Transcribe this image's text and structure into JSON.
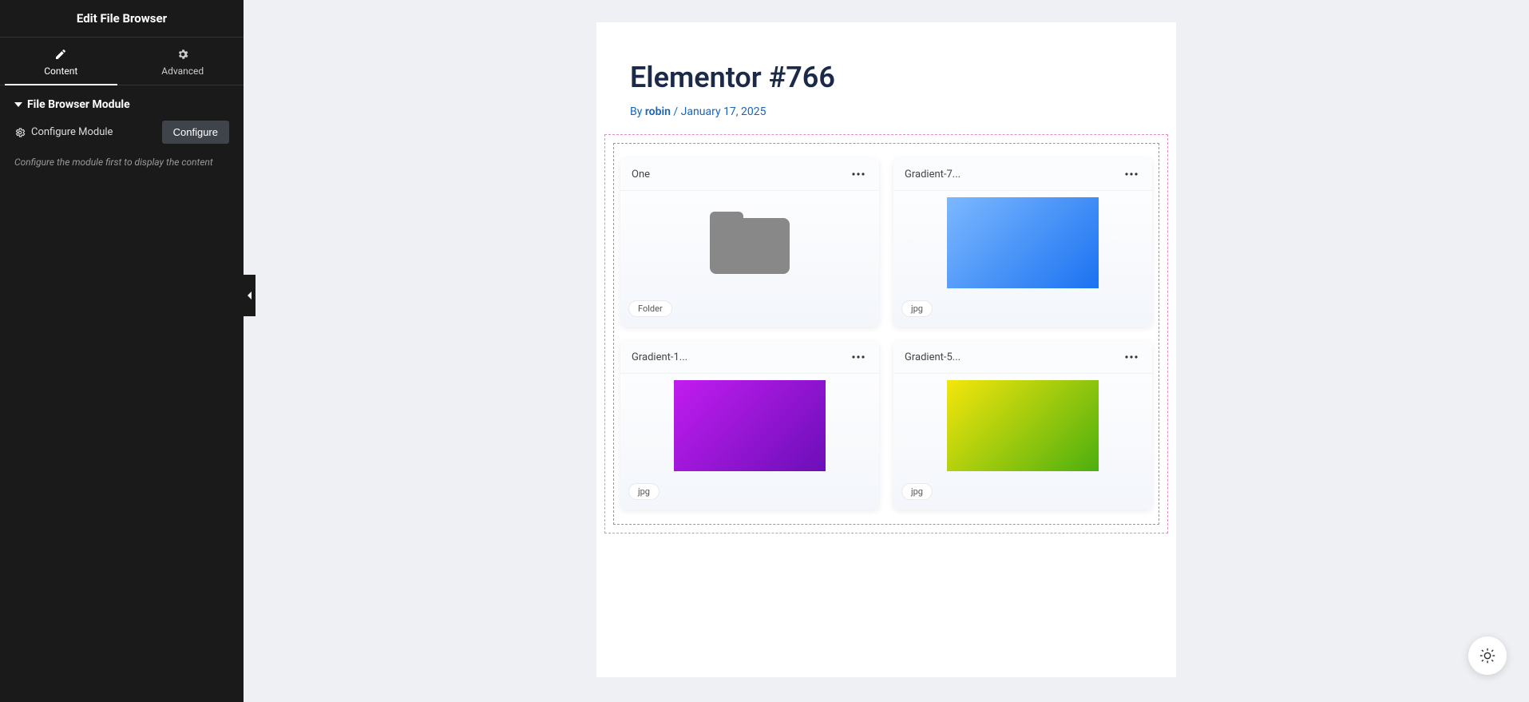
{
  "sidebar": {
    "title": "Edit File Browser",
    "tabs": [
      {
        "label": "Content",
        "icon": "pencil"
      },
      {
        "label": "Advanced",
        "icon": "gear"
      }
    ],
    "activeTab": 0,
    "section": {
      "title": "File Browser Module",
      "configureLabel": "Configure Module",
      "configureButton": "Configure",
      "note": "Configure the module first to display the content"
    }
  },
  "page": {
    "title": "Elementor #766",
    "byPrefix": "By ",
    "author": "robin",
    "sep": " / ",
    "date": "January 17, 2025"
  },
  "files": [
    {
      "name": "One",
      "type": "Folder",
      "preview": "folder"
    },
    {
      "name": "Gradient-7...",
      "type": "jpg",
      "preview": "grad-blue"
    },
    {
      "name": "Gradient-1...",
      "type": "jpg",
      "preview": "grad-purple"
    },
    {
      "name": "Gradient-5...",
      "type": "jpg",
      "preview": "grad-green"
    }
  ]
}
